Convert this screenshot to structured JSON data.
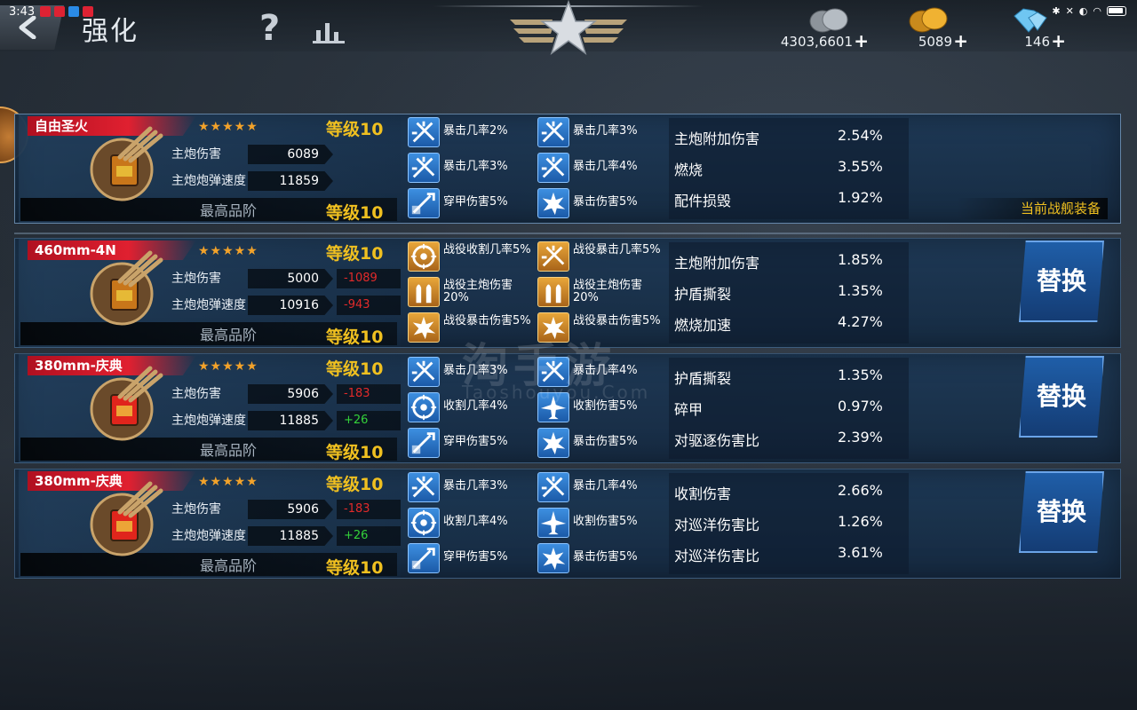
{
  "status": {
    "time": "3:43"
  },
  "header": {
    "title": "强化",
    "help": "?",
    "resources": [
      {
        "name": "silver",
        "value": "4303,6601",
        "plus": "+"
      },
      {
        "name": "gold",
        "value": "5089",
        "plus": "+"
      },
      {
        "name": "diamond",
        "value": "146",
        "plus": "+"
      }
    ]
  },
  "watermark": {
    "text": "淘手游",
    "url": "Taoshouyou.Com"
  },
  "rows": [
    {
      "name": "自由圣火",
      "stars": "★★★★★",
      "level": "等级10",
      "grade": "最高品阶",
      "stat1_label": "主炮伤害",
      "stat1_value": "6089",
      "stat2_label": "主炮炮弹速度",
      "stat2_value": "11859",
      "diff1": "",
      "diff2": "",
      "skills": [
        {
          "text": "暴击几率2%",
          "icon": "crit-icon",
          "color": "blue"
        },
        {
          "text": "暴击几率3%",
          "icon": "crit-icon",
          "color": "blue"
        },
        {
          "text": "暴击几率3%",
          "icon": "crit-icon",
          "color": "blue"
        },
        {
          "text": "暴击几率4%",
          "icon": "crit-icon",
          "color": "blue"
        },
        {
          "text": "穿甲伤害5%",
          "icon": "pierce-icon",
          "color": "blue"
        },
        {
          "text": "暴击伤害5%",
          "icon": "burst-icon",
          "color": "blue"
        }
      ],
      "attrs": [
        {
          "label": "主炮附加伤害",
          "value": "2.54%"
        },
        {
          "label": "燃烧",
          "value": "3.55%"
        },
        {
          "label": "配件损毁",
          "value": "1.92%"
        }
      ],
      "current_tag": "当前战舰装备"
    },
    {
      "name": "460mm-4N",
      "stars": "★★★★★",
      "level": "等级10",
      "grade": "最高品阶",
      "stat1_label": "主炮伤害",
      "stat1_value": "5000",
      "stat2_label": "主炮炮弹速度",
      "stat2_value": "10916",
      "diff1": "-1089",
      "diff1_type": "neg",
      "diff2": "-943",
      "diff2_type": "neg",
      "skills": [
        {
          "text": "战役收割几率5%",
          "icon": "target-icon",
          "color": "gold"
        },
        {
          "text": "战役暴击几率5%",
          "icon": "crit-icon",
          "color": "gold"
        },
        {
          "text": "战役主炮伤害20%",
          "icon": "shell-icon",
          "color": "gold"
        },
        {
          "text": "战役主炮伤害20%",
          "icon": "shell-icon",
          "color": "gold"
        },
        {
          "text": "战役暴击伤害5%",
          "icon": "burst-icon",
          "color": "gold"
        },
        {
          "text": "战役暴击伤害5%",
          "icon": "burst-icon",
          "color": "gold"
        }
      ],
      "attrs": [
        {
          "label": "主炮附加伤害",
          "value": "1.85%"
        },
        {
          "label": "护盾撕裂",
          "value": "1.35%"
        },
        {
          "label": "燃烧加速",
          "value": "4.27%"
        }
      ],
      "replace": "替换"
    },
    {
      "name": "380mm-庆典",
      "stars": "★★★★★",
      "level": "等级10",
      "grade": "最高品阶",
      "stat1_label": "主炮伤害",
      "stat1_value": "5906",
      "stat2_label": "主炮炮弹速度",
      "stat2_value": "11885",
      "diff1": "-183",
      "diff1_type": "neg",
      "diff2": "+26",
      "diff2_type": "pos",
      "skills": [
        {
          "text": "暴击几率3%",
          "icon": "crit-icon",
          "color": "blue"
        },
        {
          "text": "暴击几率4%",
          "icon": "crit-icon",
          "color": "blue"
        },
        {
          "text": "收割几率4%",
          "icon": "target-icon",
          "color": "blue"
        },
        {
          "text": "收割伤害5%",
          "icon": "plane-icon",
          "color": "blue"
        },
        {
          "text": "穿甲伤害5%",
          "icon": "pierce-icon",
          "color": "blue"
        },
        {
          "text": "暴击伤害5%",
          "icon": "burst-icon",
          "color": "blue"
        }
      ],
      "attrs": [
        {
          "label": "护盾撕裂",
          "value": "1.35%"
        },
        {
          "label": "碎甲",
          "value": "0.97%"
        },
        {
          "label": "对驱逐伤害比",
          "value": "2.39%"
        }
      ],
      "replace": "替换"
    },
    {
      "name": "380mm-庆典",
      "stars": "★★★★★",
      "level": "等级10",
      "grade": "最高品阶",
      "stat1_label": "主炮伤害",
      "stat1_value": "5906",
      "stat2_label": "主炮炮弹速度",
      "stat2_value": "11885",
      "diff1": "-183",
      "diff1_type": "neg",
      "diff2": "+26",
      "diff2_type": "pos",
      "skills": [
        {
          "text": "暴击几率3%",
          "icon": "crit-icon",
          "color": "blue"
        },
        {
          "text": "暴击几率4%",
          "icon": "crit-icon",
          "color": "blue"
        },
        {
          "text": "收割几率4%",
          "icon": "target-icon",
          "color": "blue"
        },
        {
          "text": "收割伤害5%",
          "icon": "plane-icon",
          "color": "blue"
        },
        {
          "text": "穿甲伤害5%",
          "icon": "pierce-icon",
          "color": "blue"
        },
        {
          "text": "暴击伤害5%",
          "icon": "burst-icon",
          "color": "blue"
        }
      ],
      "attrs": [
        {
          "label": "收割伤害",
          "value": "2.66%"
        },
        {
          "label": "对巡洋伤害比",
          "value": "1.26%"
        },
        {
          "label": "对巡洋伤害比",
          "value": "3.61%"
        }
      ],
      "replace": "替换"
    }
  ]
}
